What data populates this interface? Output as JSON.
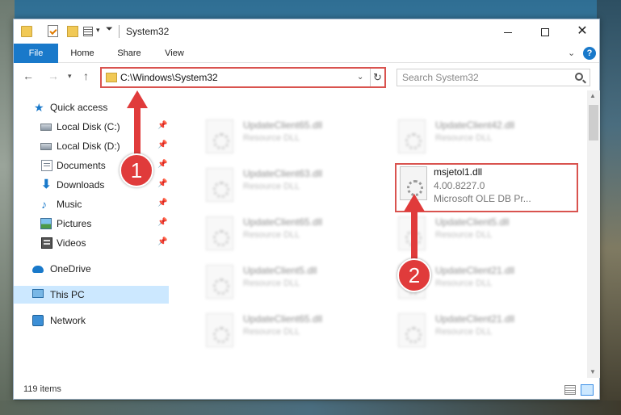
{
  "window": {
    "title": "System32"
  },
  "window_controls": {
    "minimize": "minimize",
    "maximize": "maximize",
    "close": "✕"
  },
  "ribbon": {
    "tabs": [
      "File",
      "Home",
      "Share",
      "View"
    ],
    "help": "?"
  },
  "navigation": {
    "address_path": "C:\\Windows\\System32",
    "search_placeholder": "Search System32"
  },
  "sidebar": {
    "items": [
      {
        "label": "Quick access",
        "icon": "star-icon",
        "pinned": false
      },
      {
        "label": "Local Disk (C:)",
        "icon": "drive-icon",
        "pinned": true
      },
      {
        "label": "Local Disk (D:)",
        "icon": "drive-icon",
        "pinned": true
      },
      {
        "label": "Documents",
        "icon": "documents-icon",
        "pinned": true
      },
      {
        "label": "Downloads",
        "icon": "download-arrow-icon",
        "pinned": true
      },
      {
        "label": "Music",
        "icon": "music-note-icon",
        "pinned": true
      },
      {
        "label": "Pictures",
        "icon": "pictures-icon",
        "pinned": true
      },
      {
        "label": "Videos",
        "icon": "film-icon",
        "pinned": true
      },
      {
        "label": "OneDrive",
        "icon": "cloud-icon",
        "pinned": false
      },
      {
        "label": "This PC",
        "icon": "monitor-icon",
        "pinned": false,
        "selected": true
      },
      {
        "label": "Network",
        "icon": "network-icon",
        "pinned": false
      }
    ]
  },
  "files": {
    "highlighted": {
      "name": "msjetol1.dll",
      "version": "4.00.8227.0",
      "description": "Microsoft OLE DB Pr..."
    },
    "blurred": [
      {
        "name": "UpdateClient65.dll",
        "type": "Resource DLL"
      },
      {
        "name": "UpdateClient42.dll",
        "type": "Resource DLL"
      },
      {
        "name": "UpdateClient63.dll",
        "type": "Resource DLL"
      },
      {
        "name": "UpdateClient65.dll",
        "type": "Resource DLL"
      },
      {
        "name": "UpdateClient5.dll",
        "type": "Resource DLL"
      },
      {
        "name": "UpdateClient5.dll",
        "type": "Resource DLL"
      },
      {
        "name": "UpdateClient21.dll",
        "type": "Resource DLL"
      },
      {
        "name": "UpdateClient65.dll",
        "type": "Resource DLL"
      },
      {
        "name": "UpdateClient21.dll",
        "type": "Resource DLL"
      }
    ]
  },
  "status": {
    "item_count": "119 items"
  },
  "annotations": {
    "step1": "1",
    "step2": "2"
  },
  "colors": {
    "accent": "#1979ca",
    "highlight_border": "#d9534f",
    "annotation": "#e03b3b",
    "selection": "#cce8ff"
  }
}
